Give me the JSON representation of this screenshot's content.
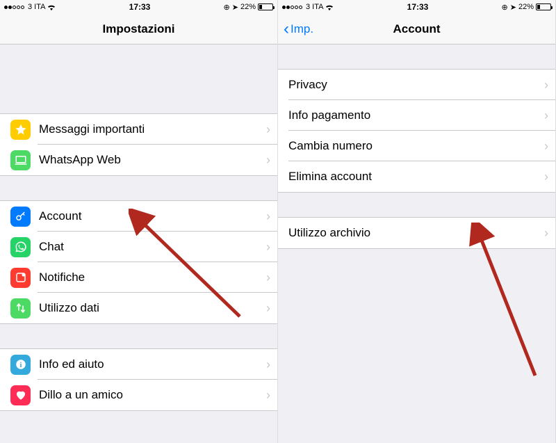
{
  "status": {
    "carrier": "3 ITA",
    "time": "17:33",
    "battery_pct": "22%",
    "dots_filled": 2,
    "dots_total": 5
  },
  "left": {
    "title": "Impostazioni",
    "sections": [
      {
        "items": [
          {
            "icon": "star-icon",
            "bg": "bg-yellow",
            "label": "Messaggi importanti"
          },
          {
            "icon": "laptop-icon",
            "bg": "bg-green-lap",
            "label": "WhatsApp Web"
          }
        ]
      },
      {
        "items": [
          {
            "icon": "key-icon",
            "bg": "bg-blue",
            "label": "Account"
          },
          {
            "icon": "whatsapp-icon",
            "bg": "bg-green-wa",
            "label": "Chat"
          },
          {
            "icon": "notification-icon",
            "bg": "bg-red-notif",
            "label": "Notifiche"
          },
          {
            "icon": "data-icon",
            "bg": "bg-green-data",
            "label": "Utilizzo dati"
          }
        ]
      },
      {
        "items": [
          {
            "icon": "info-icon",
            "bg": "bg-blue-info",
            "label": "Info ed aiuto"
          },
          {
            "icon": "heart-icon",
            "bg": "bg-red-heart",
            "label": "Dillo a un amico"
          }
        ]
      }
    ]
  },
  "right": {
    "back": "Imp.",
    "title": "Account",
    "sections": [
      {
        "items": [
          {
            "label": "Privacy"
          },
          {
            "label": "Info pagamento"
          },
          {
            "label": "Cambia numero"
          },
          {
            "label": "Elimina account"
          }
        ]
      },
      {
        "items": [
          {
            "label": "Utilizzo archivio"
          }
        ]
      }
    ]
  }
}
